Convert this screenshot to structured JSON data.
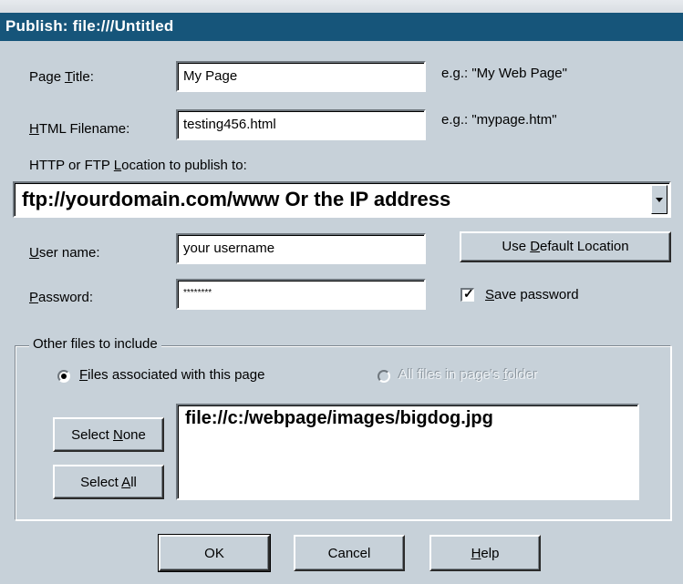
{
  "window": {
    "title": "Publish: file:///Untitled"
  },
  "page_title": {
    "label_pre": "Page ",
    "label_u": "T",
    "label_post": "itle:",
    "value": "My Page",
    "hint": "e.g.: \"My Web Page\""
  },
  "html_filename": {
    "label_u": "H",
    "label_post": "TML Filename:",
    "value": "testing456.html",
    "hint": "e.g.: \"mypage.htm\""
  },
  "location": {
    "label_pre": "HTTP or FTP ",
    "label_u": "L",
    "label_post": "ocation to publish to:",
    "value": "ftp://yourdomain.com/www  Or the IP address"
  },
  "user_name": {
    "label_u": "U",
    "label_post": "ser name:",
    "value": "your username"
  },
  "password": {
    "label_u": "P",
    "label_post": "assword:",
    "value": "********"
  },
  "use_default_location": {
    "label_pre": "Use ",
    "label_u": "D",
    "label_post": "efault Location"
  },
  "save_password": {
    "label_u": "S",
    "label_post": "ave password",
    "checked": true
  },
  "other_files": {
    "legend": "Other files to include",
    "option_associated": {
      "label_u": "F",
      "label_post": "iles associated with this page",
      "checked": true
    },
    "option_all": {
      "label_pre": "A",
      "label_post": "ll files in page's ",
      "label_u": "f",
      "label_post2": "older",
      "disabled": true
    },
    "select_none": {
      "label_pre": "Select ",
      "label_u": "N",
      "label_post": "one"
    },
    "select_all": {
      "label_pre": "Select ",
      "label_u": "A",
      "label_post": "ll"
    },
    "files": [
      "file://c:/webpage/images/bigdog.jpg"
    ]
  },
  "buttons": {
    "ok": "OK",
    "cancel": "Cancel",
    "help_u": "H",
    "help_post": "elp"
  },
  "colors": {
    "titlebar": "#16557a",
    "face": "#c7d1d9"
  }
}
